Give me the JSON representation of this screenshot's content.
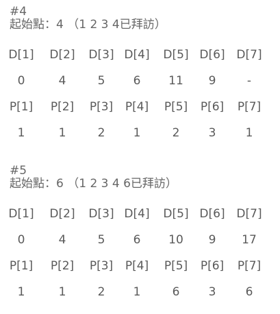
{
  "blocks": [
    {
      "title": "#4",
      "start_text": "起始點：4  （1 2 3 4已拜訪）",
      "d_headers": [
        "D[1]",
        "D[2]",
        "D[3]",
        "D[4]",
        "D[5]",
        "D[6]",
        "D[7]"
      ],
      "d_values": [
        "0",
        "4",
        "5",
        "6",
        "11",
        "9",
        "-"
      ],
      "p_headers": [
        "P[1]",
        "P[2]",
        "P[3]",
        "P[4]",
        "P[5]",
        "P[6]",
        "P[7]"
      ],
      "p_values": [
        "1",
        "1",
        "2",
        "1",
        "2",
        "3",
        "1"
      ]
    },
    {
      "title": "#5",
      "start_text": "起始點：6  （1 2 3 4 6已拜訪）",
      "d_headers": [
        "D[1]",
        "D[2]",
        "D[3]",
        "D[4]",
        "D[5]",
        "D[6]",
        "D[7]"
      ],
      "d_values": [
        "0",
        "4",
        "5",
        "6",
        "10",
        "9",
        "17"
      ],
      "p_headers": [
        "P[1]",
        "P[2]",
        "P[3]",
        "P[4]",
        "P[5]",
        "P[6]",
        "P[7]"
      ],
      "p_values": [
        "1",
        "1",
        "2",
        "1",
        "6",
        "3",
        "6"
      ]
    }
  ]
}
